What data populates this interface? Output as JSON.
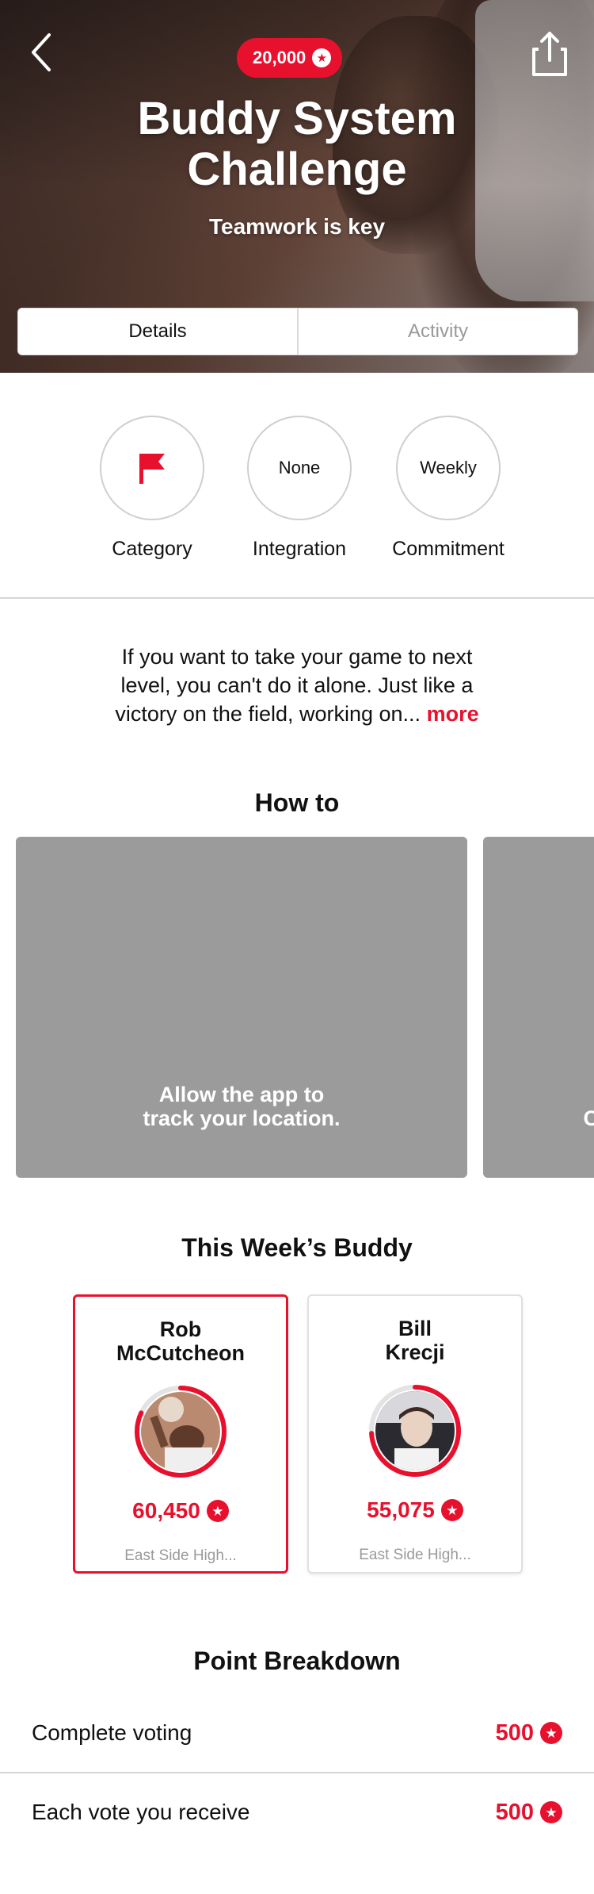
{
  "header": {
    "points": "20,000",
    "title_line1": "Buddy System",
    "title_line2": "Challenge",
    "subtitle": "Teamwork is key"
  },
  "tabs": [
    {
      "label": "Details",
      "active": true
    },
    {
      "label": "Activity",
      "active": false
    }
  ],
  "attributes": [
    {
      "icon": "flag-icon",
      "value": "",
      "label": "Category"
    },
    {
      "icon": "",
      "value": "None",
      "label": "Integration"
    },
    {
      "icon": "",
      "value": "Weekly",
      "label": "Commitment"
    }
  ],
  "description": {
    "text": "If you want to take your game to next level, you can't do it alone. Just like a victory on the field, working on...",
    "more": "more"
  },
  "howto": {
    "title": "How to",
    "cards": [
      {
        "caption_line1": "Allow the app to",
        "caption_line2": "track your location."
      },
      {
        "caption_line1": "",
        "caption_line2": "C"
      }
    ]
  },
  "buddy": {
    "title": "This Week’s Buddy",
    "people": [
      {
        "first": "Rob",
        "last": "McCutcheon",
        "points": "60,450",
        "school": "East Side High...",
        "selected": true,
        "progress": 0.82
      },
      {
        "first": "Bill",
        "last": "Krecji",
        "points": "55,075",
        "school": "East Side High...",
        "selected": false,
        "progress": 0.74
      }
    ]
  },
  "breakdown": {
    "title": "Point Breakdown",
    "rows": [
      {
        "label": "Complete voting",
        "value": "500"
      },
      {
        "label": "Each vote you receive",
        "value": "500"
      }
    ]
  },
  "colors": {
    "accent": "#e8112d",
    "card_gray": "#9b9b9b",
    "divider": "#d6d6d6"
  }
}
